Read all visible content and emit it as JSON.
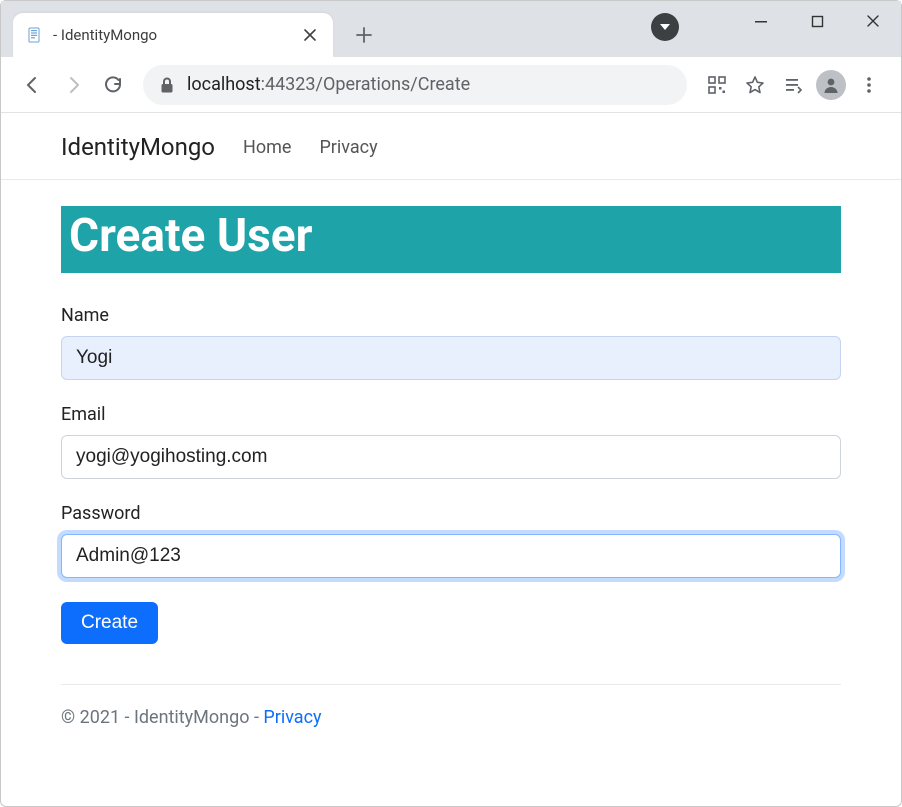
{
  "browser": {
    "tab_title": " - IdentityMongo",
    "url": {
      "host": "localhost",
      "port": ":44323",
      "path": "/Operations/Create"
    }
  },
  "site": {
    "brand": "IdentityMongo",
    "nav": {
      "home": "Home",
      "privacy": "Privacy"
    }
  },
  "page": {
    "heading": "Create User",
    "form": {
      "name": {
        "label": "Name",
        "value": "Yogi"
      },
      "email": {
        "label": "Email",
        "value": "yogi@yogihosting.com"
      },
      "password": {
        "label": "Password",
        "value": "Admin@123"
      },
      "submit_label": "Create"
    }
  },
  "footer": {
    "text": "© 2021 - IdentityMongo - ",
    "privacy_link": "Privacy"
  }
}
